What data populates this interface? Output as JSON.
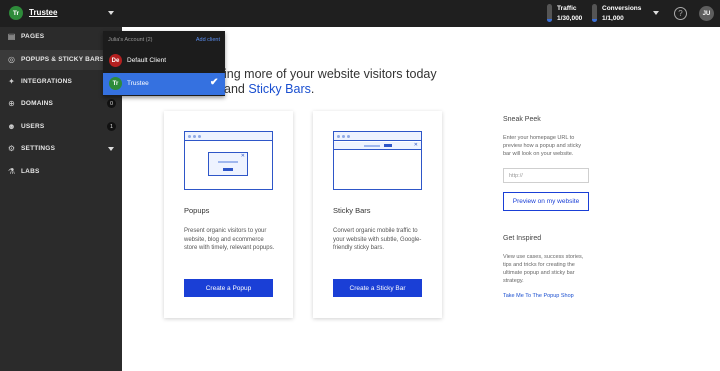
{
  "topbar": {
    "account_initials": "Tr",
    "account_name": "Trustee",
    "traffic": {
      "label": "Traffic",
      "value": "1/30,000",
      "usage": 0.0
    },
    "conversions": {
      "label": "Conversions",
      "value": "1/1,000",
      "usage": 0.0
    },
    "help_glyph": "?",
    "user_initials": "JU"
  },
  "sidebar": {
    "items": [
      {
        "label": "PAGES",
        "icon": "pages-icon",
        "glyph": "▤"
      },
      {
        "label": "POPUPS & STICKY BARS",
        "icon": "popups-icon",
        "glyph": "◎"
      },
      {
        "label": "INTEGRATIONS",
        "icon": "integrations-icon",
        "glyph": "✦"
      },
      {
        "label": "DOMAINS",
        "icon": "domains-icon",
        "glyph": "⊕",
        "badge": "0"
      },
      {
        "label": "USERS",
        "icon": "users-icon",
        "glyph": "☻",
        "badge": "1"
      },
      {
        "label": "SETTINGS",
        "icon": "settings-icon",
        "glyph": "⚙"
      },
      {
        "label": "LABS",
        "icon": "labs-icon",
        "glyph": "⚗"
      }
    ]
  },
  "dropdown": {
    "header": "Julia's Account (2)",
    "add_client": "Add client",
    "clients": [
      {
        "initials": "De",
        "name": "Default Client",
        "color": "#b32020"
      },
      {
        "initials": "Tr",
        "name": "Trustee",
        "color": "#2e8b3a",
        "selected": true
      }
    ],
    "check_glyph": "✔"
  },
  "main": {
    "headline_prefix": "ing more of your website visitors today",
    "headline_line2_prefix": "and ",
    "headline_accent": "Sticky Bars",
    "headline_suffix": ".",
    "cards": [
      {
        "title": "Popups",
        "description": "Present organic visitors to your website, blog and ecommerce store with timely, relevant popups.",
        "button": "Create a Popup",
        "close_glyph": "✕"
      },
      {
        "title": "Sticky Bars",
        "description": "Convert organic mobile traffic to your website with subtle, Google-friendly sticky bars.",
        "button": "Create a Sticky Bar",
        "close_glyph": "✕"
      }
    ]
  },
  "right_panel": {
    "sneak_peek_title": "Sneak Peek",
    "sneak_peek_text": "Enter your homepage URL to preview how a popup and sticky bar will look on your website.",
    "url_placeholder": "http://",
    "preview_button": "Preview on my website",
    "inspired_title": "Get Inspired",
    "inspired_text": "View use cases, success stories, tips and tricks for creating the ultimate popup and sticky bar strategy.",
    "shop_link": "Take Me To The Popup Shop"
  },
  "colors": {
    "brand_blue": "#1a3fd6",
    "topbar_bg": "#1f1f1f",
    "sidebar_bg": "#2b2b2b",
    "dropdown_selected": "#3571e0"
  }
}
